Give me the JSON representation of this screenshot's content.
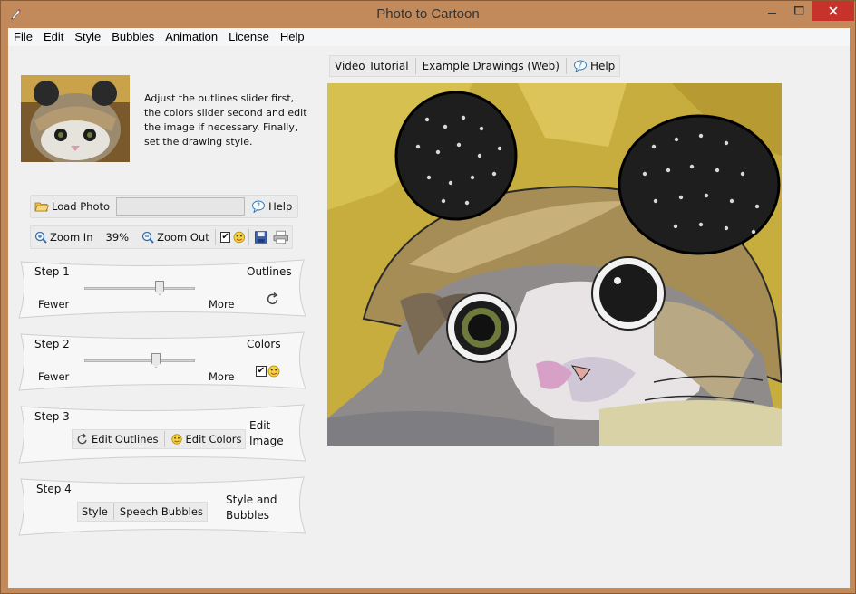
{
  "window": {
    "title": "Photo to Cartoon"
  },
  "menu": [
    "File",
    "Edit",
    "Style",
    "Bubbles",
    "Animation",
    "License",
    "Help"
  ],
  "instructions": "Adjust the outlines slider first, the colors slider second and edit the image if necessary. Finally, set the drawing style.",
  "toolbar": {
    "load_photo": "Load Photo",
    "help": "Help",
    "zoom_in": "Zoom In",
    "zoom_pct": "39%",
    "zoom_out": "Zoom Out"
  },
  "steps": {
    "step1": {
      "label": "Step 1",
      "title": "Outlines",
      "min": "Fewer",
      "max": "More",
      "slider_value": 0.7
    },
    "step2": {
      "label": "Step 2",
      "title": "Colors",
      "min": "Fewer",
      "max": "More",
      "slider_value": 0.66
    },
    "step3": {
      "label": "Step 3",
      "edit_outlines": "Edit Outlines",
      "edit_colors": "Edit Colors",
      "title_line1": "Edit",
      "title_line2": "Image"
    },
    "step4": {
      "label": "Step 4",
      "style": "Style",
      "speech_bubbles": "Speech Bubbles",
      "title_line1": "Style and",
      "title_line2": "Bubbles"
    }
  },
  "right_toolbar": {
    "video_tutorial": "Video Tutorial",
    "example_drawings": "Example Drawings (Web)",
    "help": "Help"
  },
  "colors": {
    "accent_close": "#c7322a",
    "frame": "#c2895a"
  }
}
